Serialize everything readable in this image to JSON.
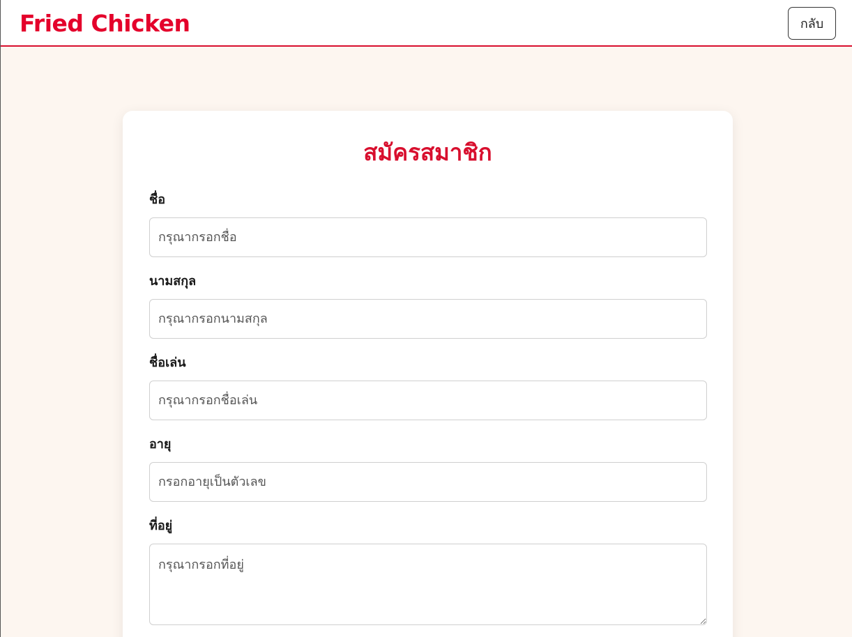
{
  "header": {
    "brand": "Fried Chicken",
    "back_label": "กลับ"
  },
  "form": {
    "title": "สมัครสมาชิก",
    "first_name": {
      "label": "ชื่อ",
      "placeholder": "กรุณากรอกชื่อ",
      "value": ""
    },
    "last_name": {
      "label": "นามสกุล",
      "placeholder": "กรุณากรอกนามสกุล",
      "value": ""
    },
    "nickname": {
      "label": "ชื่อเล่น",
      "placeholder": "กรุณากรอกชื่อเล่น",
      "value": ""
    },
    "age": {
      "label": "อายุ",
      "placeholder": "กรอกอายุเป็นตัวเลข",
      "value": ""
    },
    "address": {
      "label": "ที่อยู่",
      "placeholder": "กรุณากรอกที่อยู่",
      "value": ""
    }
  },
  "colors": {
    "brand": "#e4002b",
    "accent": "#d80f2e",
    "page_background": "#fdf6f0"
  }
}
